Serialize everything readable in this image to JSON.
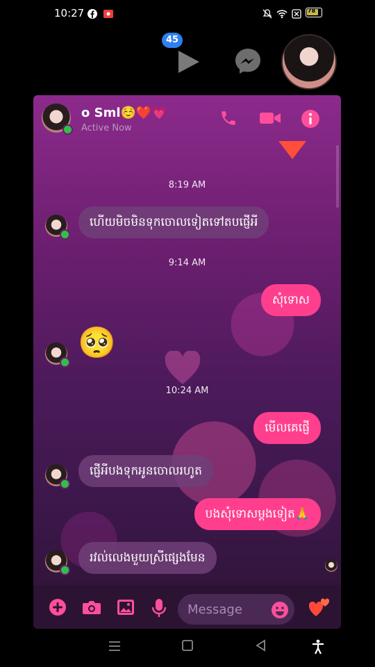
{
  "status_bar": {
    "time": "10:27",
    "battery": "78",
    "icons": [
      "facebook-icon",
      "record-icon",
      "mute-icon",
      "wifi-icon",
      "data-icon",
      "battery-icon"
    ]
  },
  "chat_heads": {
    "badge_count": "45",
    "icons": [
      "play-icon",
      "messenger-icon"
    ]
  },
  "header": {
    "name": "o Sml☺️❤️💗",
    "status": "Active Now",
    "buttons": [
      "phone-icon",
      "video-icon",
      "info-icon"
    ]
  },
  "messages": [
    {
      "type": "timestamp",
      "text": "8:19 AM"
    },
    {
      "type": "in",
      "text": "ហើយមិចមិនទុកចោលទៀតទៅតបផ្ញើអី"
    },
    {
      "type": "timestamp",
      "text": "9:14 AM"
    },
    {
      "type": "out",
      "text": "សុំទោស"
    },
    {
      "type": "in-emoji",
      "text": "🥺"
    },
    {
      "type": "timestamp",
      "text": "10:24 AM"
    },
    {
      "type": "out",
      "text": "មើលគេផ្ញើ"
    },
    {
      "type": "in",
      "text": "ផ្ញើអីបងទុកអូនចោលរហូត"
    },
    {
      "type": "out",
      "text": "បងសុំទោសម្ដងទៀត🙏"
    },
    {
      "type": "in",
      "text": "រវល់លេងមួយស្រីផ្សេងមែន"
    }
  ],
  "composer": {
    "placeholder": "Message",
    "icons": [
      "plus-icon",
      "camera-icon",
      "gallery-icon",
      "mic-icon",
      "emoji-icon",
      "hearts-icon"
    ]
  },
  "colors": {
    "accent": "#ff3f8e",
    "card_top": "#8c2a8c",
    "card_bottom": "#2d1333"
  }
}
